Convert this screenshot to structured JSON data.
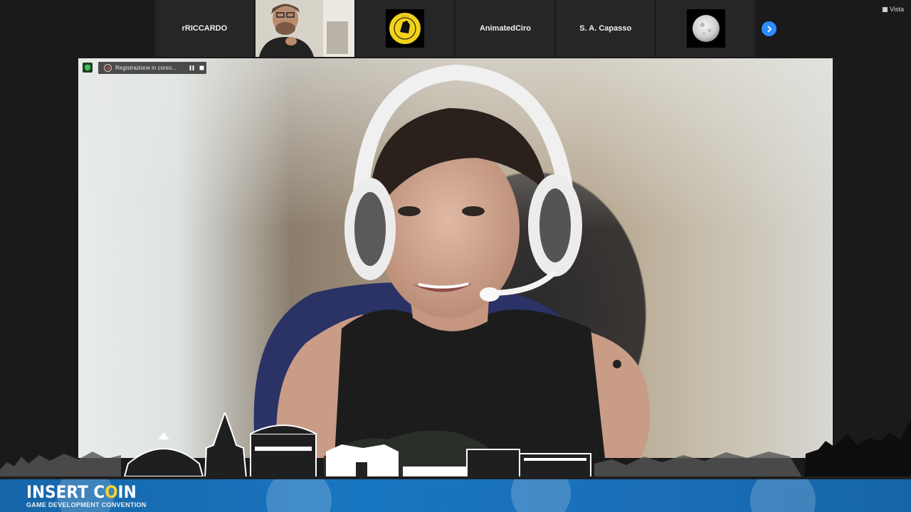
{
  "participants": [
    {
      "name": "rRICCARDO",
      "type": "name"
    },
    {
      "name": "",
      "type": "video"
    },
    {
      "name": "",
      "type": "logo"
    },
    {
      "name": "AnimatedCiro",
      "type": "name"
    },
    {
      "name": "S. A. Capasso",
      "type": "name"
    },
    {
      "name": "",
      "type": "moon"
    }
  ],
  "toolbar": {
    "view_label": "Vista",
    "view_icon": "grid-icon",
    "next_icon": "chevron-right-icon"
  },
  "recording": {
    "status_text": "Registrazione in corso...",
    "pause_icon": "pause-icon",
    "stop_icon": "stop-icon",
    "record_dot_color": "#e23b3b"
  },
  "security": {
    "icon": "shield-icon",
    "color": "#3fbf5a"
  },
  "branding": {
    "title_pre": "INSERT C",
    "title_coin": "O",
    "title_post": "IN",
    "subtitle": "GAME DEVELOPMENT CONVENTION"
  },
  "colors": {
    "accent": "#2d8cff",
    "footer": "#1976c0",
    "coin": "#f6d32d"
  }
}
